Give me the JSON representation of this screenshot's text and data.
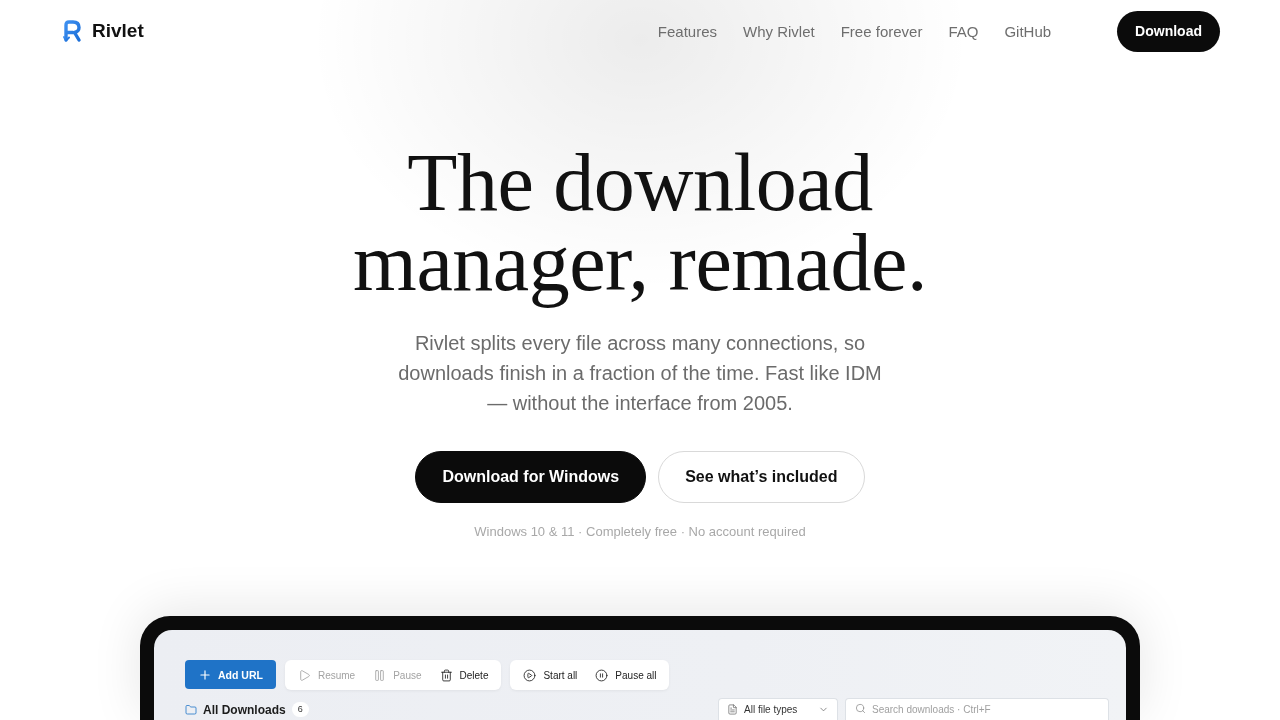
{
  "nav": {
    "brand": "Rivlet",
    "links": [
      "Features",
      "Why Rivlet",
      "Free forever",
      "FAQ",
      "GitHub"
    ],
    "cta": "Download"
  },
  "hero": {
    "title": "The download manager, remade.",
    "subtitle": "Rivlet splits every file across many connections, so downloads finish in a fraction of the time. Fast like IDM — without the interface from 2005.",
    "buttons": [
      {
        "label": "Download for Windows",
        "kind": "primary"
      },
      {
        "label": "See what’s included",
        "kind": "secondary"
      }
    ],
    "note": "Windows 10 & 11 · Completely free · No account required"
  },
  "app_preview": {
    "add_button": "Add URL",
    "toolbar_groups": [
      {
        "items": [
          {
            "label": "Resume",
            "kind": "play",
            "disabled": true
          },
          {
            "label": "Pause",
            "kind": "pause",
            "disabled": true
          },
          {
            "label": "Delete",
            "kind": "trash",
            "disabled": false
          }
        ]
      },
      {
        "items": [
          {
            "label": "Start all",
            "kind": "play_circle",
            "disabled": false
          },
          {
            "label": "Pause all",
            "kind": "pause_circle",
            "disabled": false
          }
        ]
      }
    ],
    "list_header": {
      "title": "All Downloads",
      "count": "6"
    },
    "type_filter": {
      "value": "All file types"
    },
    "search": {
      "placeholder": "Search downloads · Ctrl+F"
    }
  }
}
